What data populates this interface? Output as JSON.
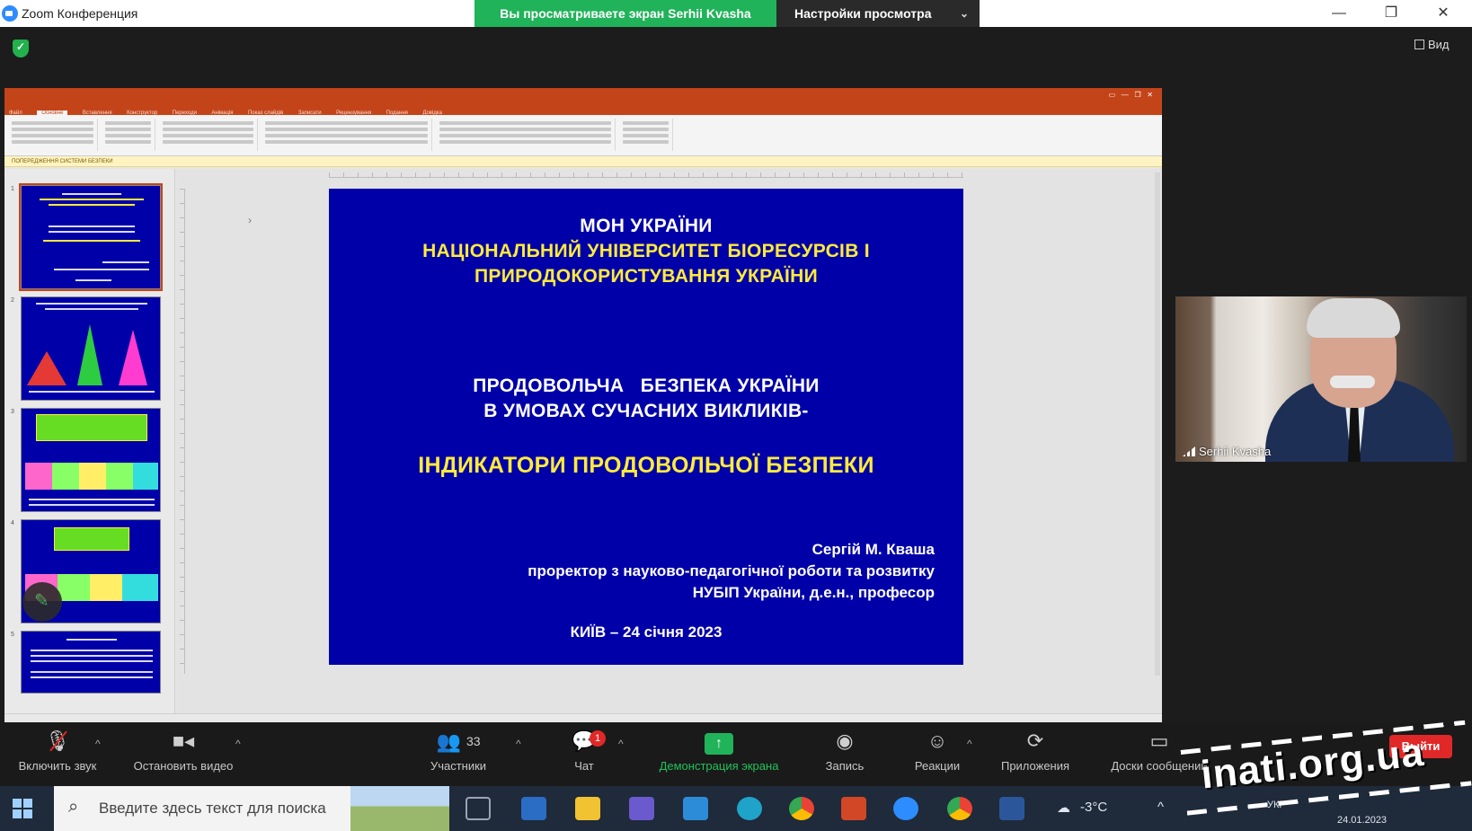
{
  "window": {
    "title": "Zoom Конференция",
    "share_banner": "Вы просматриваете экран Serhii Kvasha",
    "view_settings": "Настройки просмотра",
    "view_label": "Вид"
  },
  "ppt": {
    "tabs": [
      "Файл",
      "Основне",
      "Вставлення",
      "Конструктор",
      "Переходи",
      "Анімація",
      "Показ слайдів",
      "Записати",
      "Рецензування",
      "Подання",
      "Довідка"
    ],
    "warning": "ПОПЕРЕДЖЕННЯ СИСТЕМИ БЕЗПЕКИ",
    "thumb_numbers": [
      "1",
      "2",
      "3",
      "4",
      "5"
    ]
  },
  "slide": {
    "line1": "МОН УКРАЇНИ",
    "line2": "НАЦІОНАЛЬНИЙ УНІВЕРСИТЕТ БІОРЕСУРСІВ І",
    "line3": "ПРИРОДОКОРИСТУВАННЯ УКРАЇНИ",
    "line4": "ПРОДОВОЛЬЧА   БЕЗПЕКА УКРАЇНИ",
    "line5": "В УМОВАХ СУЧАСНИХ ВИКЛИКІВ-",
    "line6": "ІНДИКАТОРИ ПРОДОВОЛЬЧОЇ БЕЗПЕКИ",
    "author": "Сергій М. Кваша",
    "position": "проректор з науково-педагогічної роботи та розвитку",
    "affiliation": "НУБІП України, д.е.н., професор",
    "place_date": "КИЇВ – 24 січня 2023"
  },
  "participant": {
    "name": "Serhii Kvasha"
  },
  "toolbar": {
    "unmute": "Включить звук",
    "stop_video": "Остановить видео",
    "participants": "Участники",
    "participants_count": "33",
    "chat": "Чат",
    "chat_badge": "1",
    "share": "Демонстрация экрана",
    "record": "Запись",
    "reactions": "Реакции",
    "apps": "Приложения",
    "whiteboards": "Доски сообщений",
    "leave": "Выйти"
  },
  "taskbar": {
    "search_placeholder": "Введите здесь текст для поиска",
    "weather": "-3°C",
    "lang": "УКР",
    "date": "24.01.2023"
  },
  "watermark": "inati.org.ua",
  "colors": {
    "slide_bg": "#0000a8",
    "slide_yellow": "#ffeb3b",
    "zoom_green": "#20b35a",
    "ppt_orange": "#c4441a",
    "leave_red": "#e02828"
  }
}
